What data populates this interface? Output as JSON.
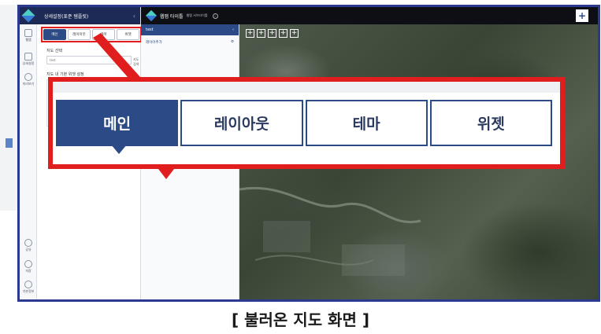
{
  "app": {
    "settings_title": "상세설정(표준 템플릿)",
    "map_title": "웹맵 타이틀",
    "map_subtitle": "웹맵 서브타이틀"
  },
  "rail": {
    "items": [
      {
        "label": "웹맵",
        "icon": "map-icon"
      },
      {
        "label": "상세설정",
        "icon": "settings-icon"
      },
      {
        "label": "미리보기",
        "icon": "eye-icon"
      }
    ],
    "bottom_items": [
      {
        "label": "공유",
        "icon": "share-icon"
      },
      {
        "label": "저장",
        "icon": "save-icon"
      },
      {
        "label": "기본정보",
        "icon": "info-icon"
      }
    ]
  },
  "mini_tabs": [
    "메인",
    "레이아웃",
    "테마",
    "위젯"
  ],
  "settings": {
    "map_select_label": "지도 선택",
    "input_value": "test",
    "input_button": "지도검색",
    "sub_label": "지도 내 기본 위젯 설정"
  },
  "layer_panel": {
    "title": "test",
    "add_layer": "레이어추가"
  },
  "map_tools": [
    "+",
    "+",
    "+",
    "+",
    "+"
  ],
  "callout_tabs": [
    {
      "label": "메인",
      "active": true
    },
    {
      "label": "레이아웃",
      "active": false
    },
    {
      "label": "테마",
      "active": false
    },
    {
      "label": "위젯",
      "active": false
    }
  ],
  "caption": "[ 불러온 지도 화면 ]",
  "colors": {
    "accent": "#2b4a86",
    "highlight": "#e01e1e",
    "header": "#1d2a55"
  }
}
